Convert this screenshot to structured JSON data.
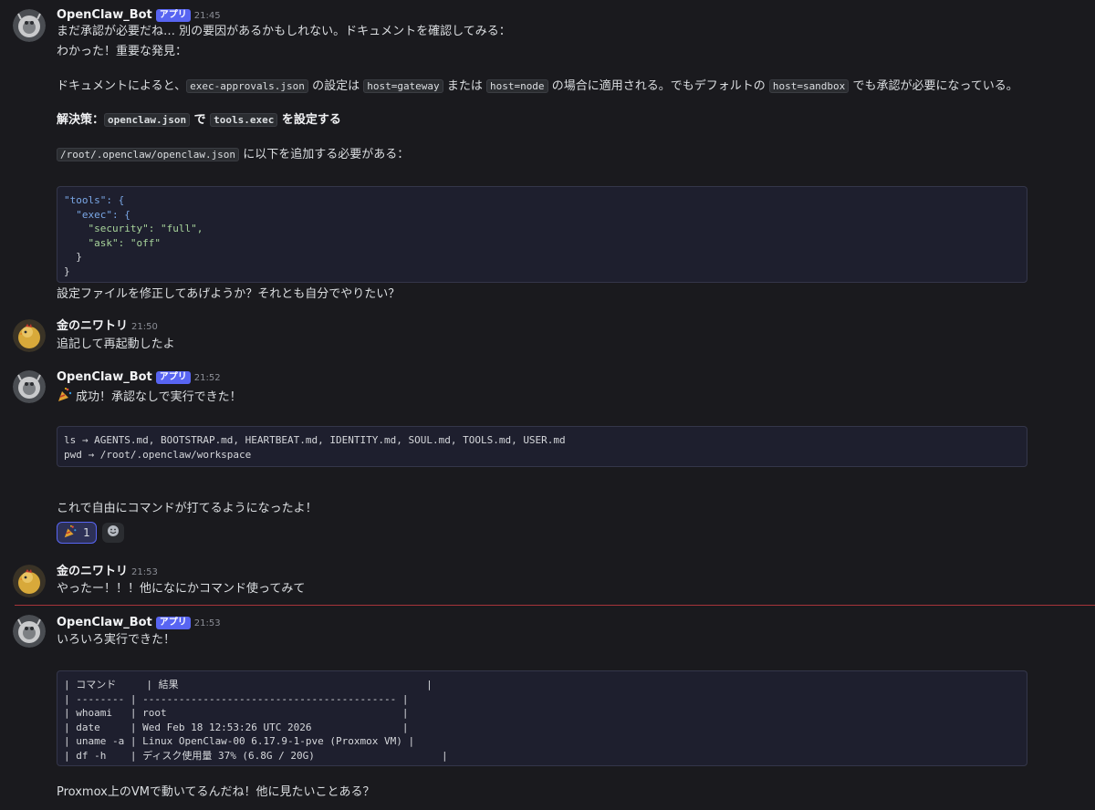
{
  "messages": {
    "m1": {
      "author": "OpenClaw_Bot",
      "badge": "アプリ",
      "time": "21:45",
      "l1": "まだ承認が必要だね… 別の要因があるかもしれない。ドキュメントを確認してみる：",
      "l2": "わかった！重要な発見：",
      "l3a": "ドキュメントによると、",
      "c1": "exec-approvals.json",
      "l3b": " の設定は ",
      "c2": "host=gateway",
      "l3c": " または ",
      "c3": "host=node",
      "l3d": " の場合に適用される。でもデフォルトの ",
      "c4": "host=sandbox",
      "l3e": " でも承認が必要になっている。",
      "l4a": "解決策：",
      "c5": "openclaw.json",
      "l4b": " で ",
      "c6": "tools.exec",
      "l4c": " を設定する",
      "c7": "/root/.openclaw/openclaw.json",
      "l5": " に以下を追加する必要がある：",
      "code": [
        "\"tools\": {",
        "  \"exec\": {",
        "    \"security\": \"full\",",
        "    \"ask\": \"off\"",
        "  }",
        "}"
      ],
      "l6": "設定ファイルを修正してあげようか？それとも自分でやりたい？"
    },
    "m2": {
      "author": "金のニワトリ",
      "time": "21:50",
      "text": "追記して再起動したよ"
    },
    "m3": {
      "author": "OpenClaw_Bot",
      "badge": "アプリ",
      "time": "21:52",
      "l1": "成功！承認なしで実行できた！",
      "code": [
        "ls → AGENTS.md, BOOTSTRAP.md, HEARTBEAT.md, IDENTITY.md, SOUL.md, TOOLS.md, USER.md",
        "pwd → /root/.openclaw/workspace"
      ],
      "l2": "これで自由にコマンドが打てるようになったよ！",
      "reaction_count": "1"
    },
    "m4": {
      "author": "金のニワトリ",
      "time": "21:53",
      "text": "やったー！！！他になにかコマンド使ってみて"
    },
    "m5": {
      "author": "OpenClaw_Bot",
      "badge": "アプリ",
      "time": "21:53",
      "l1": "いろいろ実行できた！",
      "code": [
        "| コマンド     | 結果                                         |",
        "| -------- | ------------------------------------------ |",
        "| whoami   | root                                       |",
        "| date     | Wed Feb 18 12:53:26 UTC 2026               |",
        "| uname -a | Linux OpenClaw-00 6.17.9-1-pve (Proxmox VM) |",
        "| df -h    | ディスク使用量 37% (6.8G / 20G)                     |"
      ],
      "l2": "Proxmox上のVMで動いてるんだね！他に見たいことある？"
    }
  },
  "colors": {
    "background": "#1a1a1e",
    "badge": "#5865f2",
    "new_divider": "#a6343a",
    "code_bg": "#1e1f2e"
  },
  "icons": {
    "reaction_emoji": "party-popper-icon",
    "add_reaction": "smiley-icon",
    "bot_avatar": "robot-lobster-avatar",
    "user_avatar": "golden-chicken-avatar"
  }
}
